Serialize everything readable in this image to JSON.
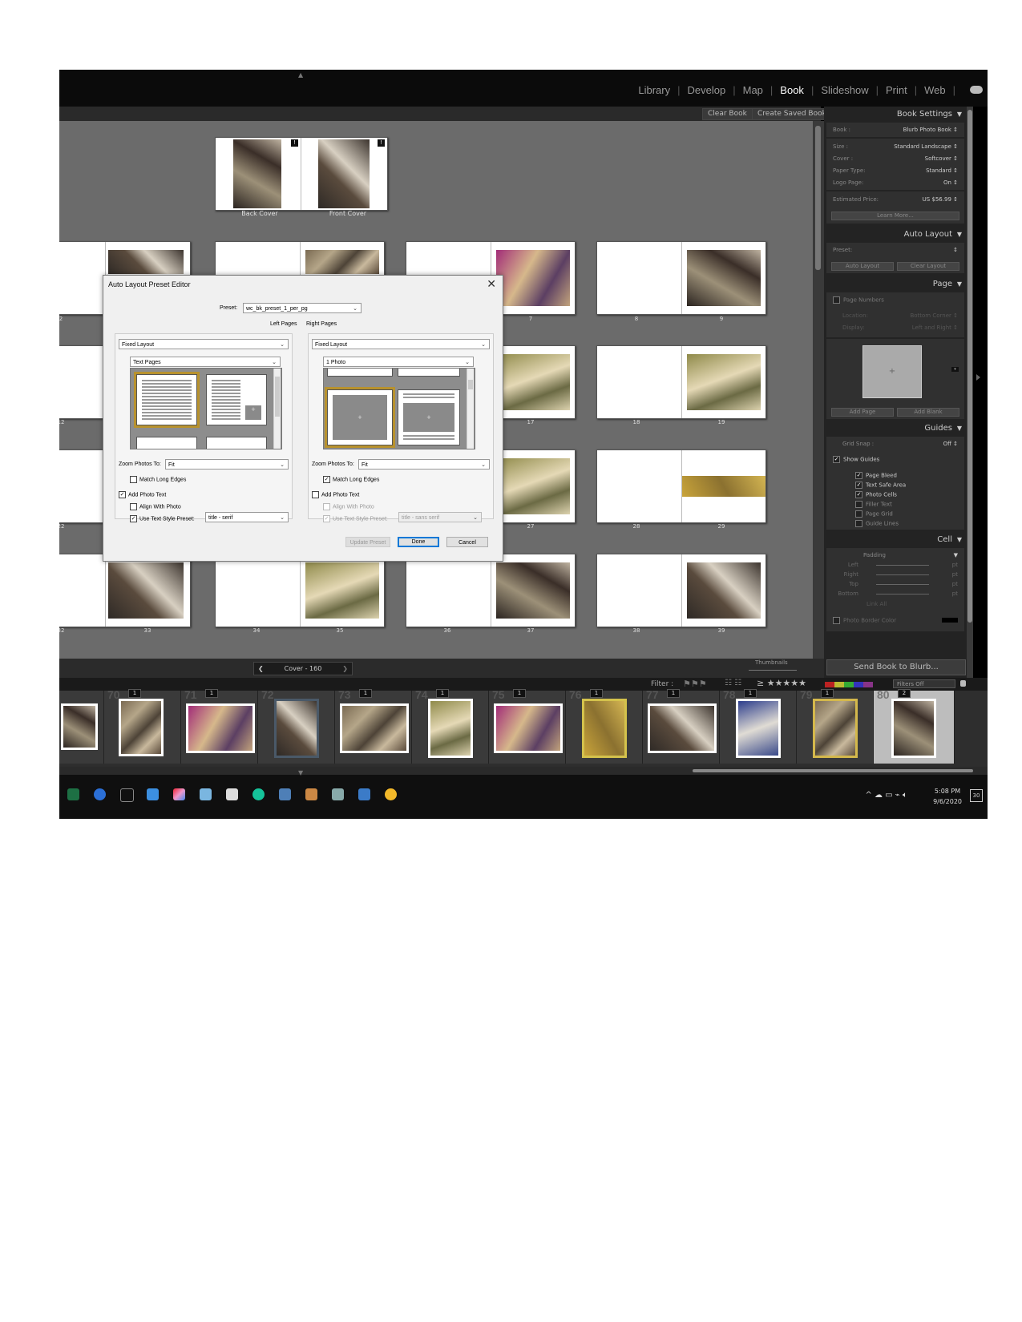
{
  "modules": [
    "Library",
    "Develop",
    "Map",
    "Book",
    "Slideshow",
    "Print",
    "Web"
  ],
  "active_module": "Book",
  "toolbar": {
    "clear_book": "Clear Book",
    "create_saved_book": "Create Saved Book"
  },
  "cover": {
    "back": "Back Cover",
    "front": "Front Cover"
  },
  "page_numbers": [
    "2",
    "7",
    "8",
    "9",
    "12",
    "17",
    "18",
    "19",
    "22",
    "27",
    "28",
    "29",
    "32",
    "33",
    "34",
    "35",
    "36",
    "37",
    "38",
    "39"
  ],
  "bottom": {
    "pager": "Cover - 160",
    "thumbnails": "Thumbnails"
  },
  "right_panel": {
    "book_settings": {
      "header": "Book Settings",
      "book_label": "Book :",
      "book_value": "Blurb Photo Book ↕",
      "size_label": "Size :",
      "size_value": "Standard Landscape ↕",
      "cover_label": "Cover :",
      "cover_value": "Softcover ↕",
      "paper_label": "Paper Type:",
      "paper_value": "Standard ↕",
      "logo_label": "Logo Page:",
      "logo_value": "On ↕",
      "price_label": "Estimated Price:",
      "price_value": "US $56.99 ↕",
      "learn_more": "Learn More..."
    },
    "auto_layout": {
      "header": "Auto Layout",
      "preset_label": "Preset:",
      "auto_layout_btn": "Auto Layout",
      "clear_layout_btn": "Clear Layout"
    },
    "page": {
      "header": "Page",
      "page_numbers": "Page Numbers",
      "location_label": "Location:",
      "location_value": "Bottom Corner ↕",
      "display_label": "Display:",
      "display_value": "Left and Right ↕",
      "add_page": "Add Page",
      "add_blank": "Add Blank"
    },
    "guides": {
      "header": "Guides",
      "grid_snap_label": "Grid Snap :",
      "grid_snap_value": "Off ↕",
      "show_guides": "Show Guides",
      "items": [
        {
          "label": "Page Bleed",
          "checked": "✓"
        },
        {
          "label": "Text Safe Area",
          "checked": "✓"
        },
        {
          "label": "Photo Cells",
          "checked": "✓"
        },
        {
          "label": "Filler Text",
          "checked": ""
        },
        {
          "label": "Page Grid",
          "checked": ""
        },
        {
          "label": "Guide Lines",
          "checked": ""
        }
      ]
    },
    "cell": {
      "header": "Cell",
      "padding": "Padding",
      "rows": [
        {
          "label": "Left",
          "unit": "pt"
        },
        {
          "label": "Right",
          "unit": "pt"
        },
        {
          "label": "Top",
          "unit": "pt"
        },
        {
          "label": "Bottom",
          "unit": "pt"
        }
      ],
      "link_all": "Link All",
      "photo_border_color": "Photo Border Color"
    },
    "send_button": "Send Book to Blurb..."
  },
  "filmstrip": {
    "filter_label": "Filter :",
    "filters_off": "Filters Off",
    "cells": [
      {
        "num": "",
        "badge": ""
      },
      {
        "num": "70",
        "badge": "1"
      },
      {
        "num": "71",
        "badge": "1"
      },
      {
        "num": "72",
        "badge": ""
      },
      {
        "num": "73",
        "badge": "1"
      },
      {
        "num": "74",
        "badge": "1"
      },
      {
        "num": "75",
        "badge": "1"
      },
      {
        "num": "76",
        "badge": "1"
      },
      {
        "num": "77",
        "badge": "1"
      },
      {
        "num": "78",
        "badge": "1"
      },
      {
        "num": "79",
        "badge": "1"
      },
      {
        "num": "80",
        "badge": "2"
      }
    ]
  },
  "taskbar": {
    "time": "5:08 PM",
    "date": "9/6/2020",
    "notifications": "30"
  },
  "dialog": {
    "title": "Auto Layout Preset Editor",
    "close": "✕",
    "preset_label": "Preset:",
    "preset_value": "wc_bk_preset_1_per_pg",
    "left_pages": "Left Pages",
    "right_pages": "Right Pages",
    "left": {
      "layout": "Fixed Layout",
      "template": "Text Pages",
      "zoom_label": "Zoom Photos To:",
      "zoom_value": "Fit",
      "match_long_edges": "Match Long Edges",
      "match_checked": "",
      "add_photo_text": "Add Photo Text",
      "add_text_checked": "✓",
      "align_with_photo": "Align With Photo",
      "align_checked": "",
      "use_text_style": "Use Text Style Preset:",
      "use_text_checked": "✓",
      "text_style_value": "title - serif"
    },
    "right": {
      "layout": "Fixed Layout",
      "template": "1 Photo",
      "zoom_label": "Zoom Photos To:",
      "zoom_value": "Fit",
      "match_long_edges": "Match Long Edges",
      "match_checked": "✓",
      "add_photo_text": "Add Photo Text",
      "add_text_checked": "",
      "align_with_photo": "Align With Photo",
      "align_checked": "",
      "use_text_style": "Use Text Style Preset:",
      "use_text_checked": "✓",
      "text_style_value": "title - sans serif"
    },
    "update_preset": "Update Preset",
    "done": "Done",
    "cancel": "Cancel"
  }
}
